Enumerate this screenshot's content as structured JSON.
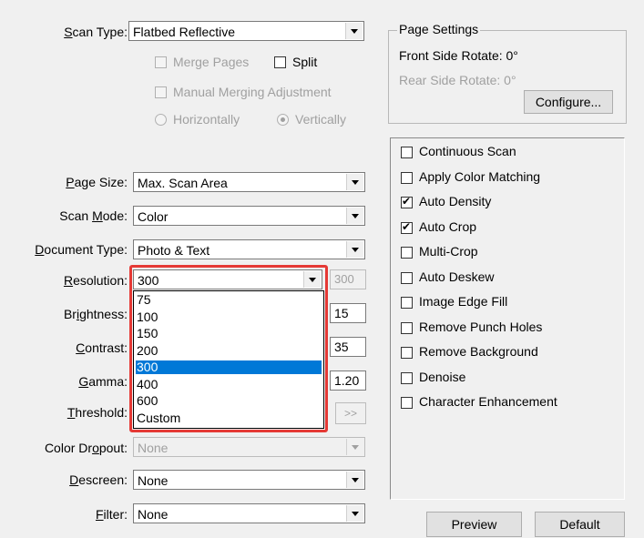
{
  "scan_type": {
    "label_prefix": "",
    "label_key": "S",
    "label_rest": "can Type:",
    "value": "Flatbed Reflective"
  },
  "merge_pages": {
    "label": "Merge Pages",
    "checked": false,
    "enabled": false
  },
  "split": {
    "label": "Split",
    "checked": false,
    "enabled": true
  },
  "manual_merging": {
    "label": "Manual Merging Adjustment",
    "checked": false,
    "enabled": false
  },
  "horizontally": {
    "label": "Horizontally",
    "selected": false,
    "enabled": false
  },
  "vertically": {
    "label": "Vertically",
    "selected": true,
    "enabled": false
  },
  "page_settings": {
    "title": "Page Settings",
    "front_rotate": "Front Side Rotate: 0°",
    "rear_rotate": "Rear Side Rotate: 0°",
    "configure_label": "Configure..."
  },
  "page_size": {
    "label_key": "P",
    "label_rest": "age Size:",
    "value": "Max. Scan Area"
  },
  "scan_mode": {
    "label_pre": "Scan ",
    "label_key": "M",
    "label_rest": "ode:",
    "value": "Color"
  },
  "document_type": {
    "label_key": "D",
    "label_rest": "ocument Type:",
    "value": "Photo & Text"
  },
  "resolution": {
    "label_key": "R",
    "label_rest": "esolution:",
    "value": "300",
    "custom_value": "300",
    "options": [
      "75",
      "100",
      "150",
      "200",
      "300",
      "400",
      "600",
      "Custom"
    ],
    "selected_index": 4
  },
  "brightness": {
    "label_pre": "Br",
    "label_key": "i",
    "label_rest": "ghtness:",
    "value": "15"
  },
  "contrast": {
    "label_key": "C",
    "label_rest": "ontrast:",
    "value": "35"
  },
  "gamma": {
    "label_key": "G",
    "label_rest": "amma:",
    "value": "1.20"
  },
  "threshold": {
    "label_key": "T",
    "label_rest": "hreshold:",
    "button_label": ">>"
  },
  "color_dropout": {
    "label_pre": "Color Dr",
    "label_key": "o",
    "label_rest": "pout:",
    "value": "None"
  },
  "descreen": {
    "label_key": "D",
    "label_rest": "escreen:",
    "value": "None"
  },
  "filter": {
    "label_key": "F",
    "label_rest": "ilter:",
    "value": "None"
  },
  "options_panel": [
    {
      "label": "Continuous Scan",
      "checked": false
    },
    {
      "label": "Apply Color Matching",
      "checked": false
    },
    {
      "label": "Auto Density",
      "checked": true
    },
    {
      "label": "Auto Crop",
      "checked": true
    },
    {
      "label": "Multi-Crop",
      "checked": false
    },
    {
      "label": "Auto Deskew",
      "checked": false
    },
    {
      "label": "Image Edge Fill",
      "checked": false
    },
    {
      "label": "Remove Punch Holes",
      "checked": false
    },
    {
      "label": "Remove Background",
      "checked": false
    },
    {
      "label": "Denoise",
      "checked": false
    },
    {
      "label": "Character Enhancement",
      "checked": false
    }
  ],
  "buttons": {
    "preview": "Preview",
    "default": "Default"
  },
  "colors": {
    "highlight": "#e53935",
    "selection": "#0078d7"
  }
}
